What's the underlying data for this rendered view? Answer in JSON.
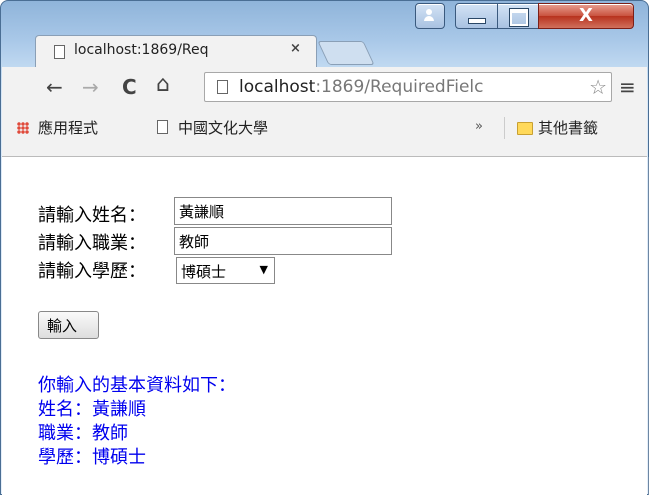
{
  "browser": {
    "tab_title": "localhost:1869/Req",
    "tab_close": "×",
    "url_host": "localhost",
    "url_rest": ":1869/RequiredFielc",
    "nav_back": "←",
    "nav_forward": "→",
    "nav_reload": "C",
    "nav_home": "⌂",
    "star": "☆",
    "menu": "≡",
    "window_controls": {
      "close": "X"
    },
    "bookmarks": {
      "apps": "應用程式",
      "site": "中國文化大學",
      "more": "»",
      "other": "其他書籤"
    }
  },
  "form": {
    "name_label": "請輸入姓名：",
    "name_value": "黃謙順",
    "job_label": "請輸入職業：",
    "job_value": "教師",
    "edu_label": "請輸入學歷：",
    "edu_selected": "博碩士",
    "submit_label": "輸入"
  },
  "result": {
    "heading": "你輸入的基本資料如下：",
    "name_line": "姓名：黃謙順",
    "job_line": "職業：教師",
    "edu_line": "學歷：博碩士"
  },
  "colors": {
    "result_text": "#0000ee",
    "close_button": "#c9523e"
  }
}
